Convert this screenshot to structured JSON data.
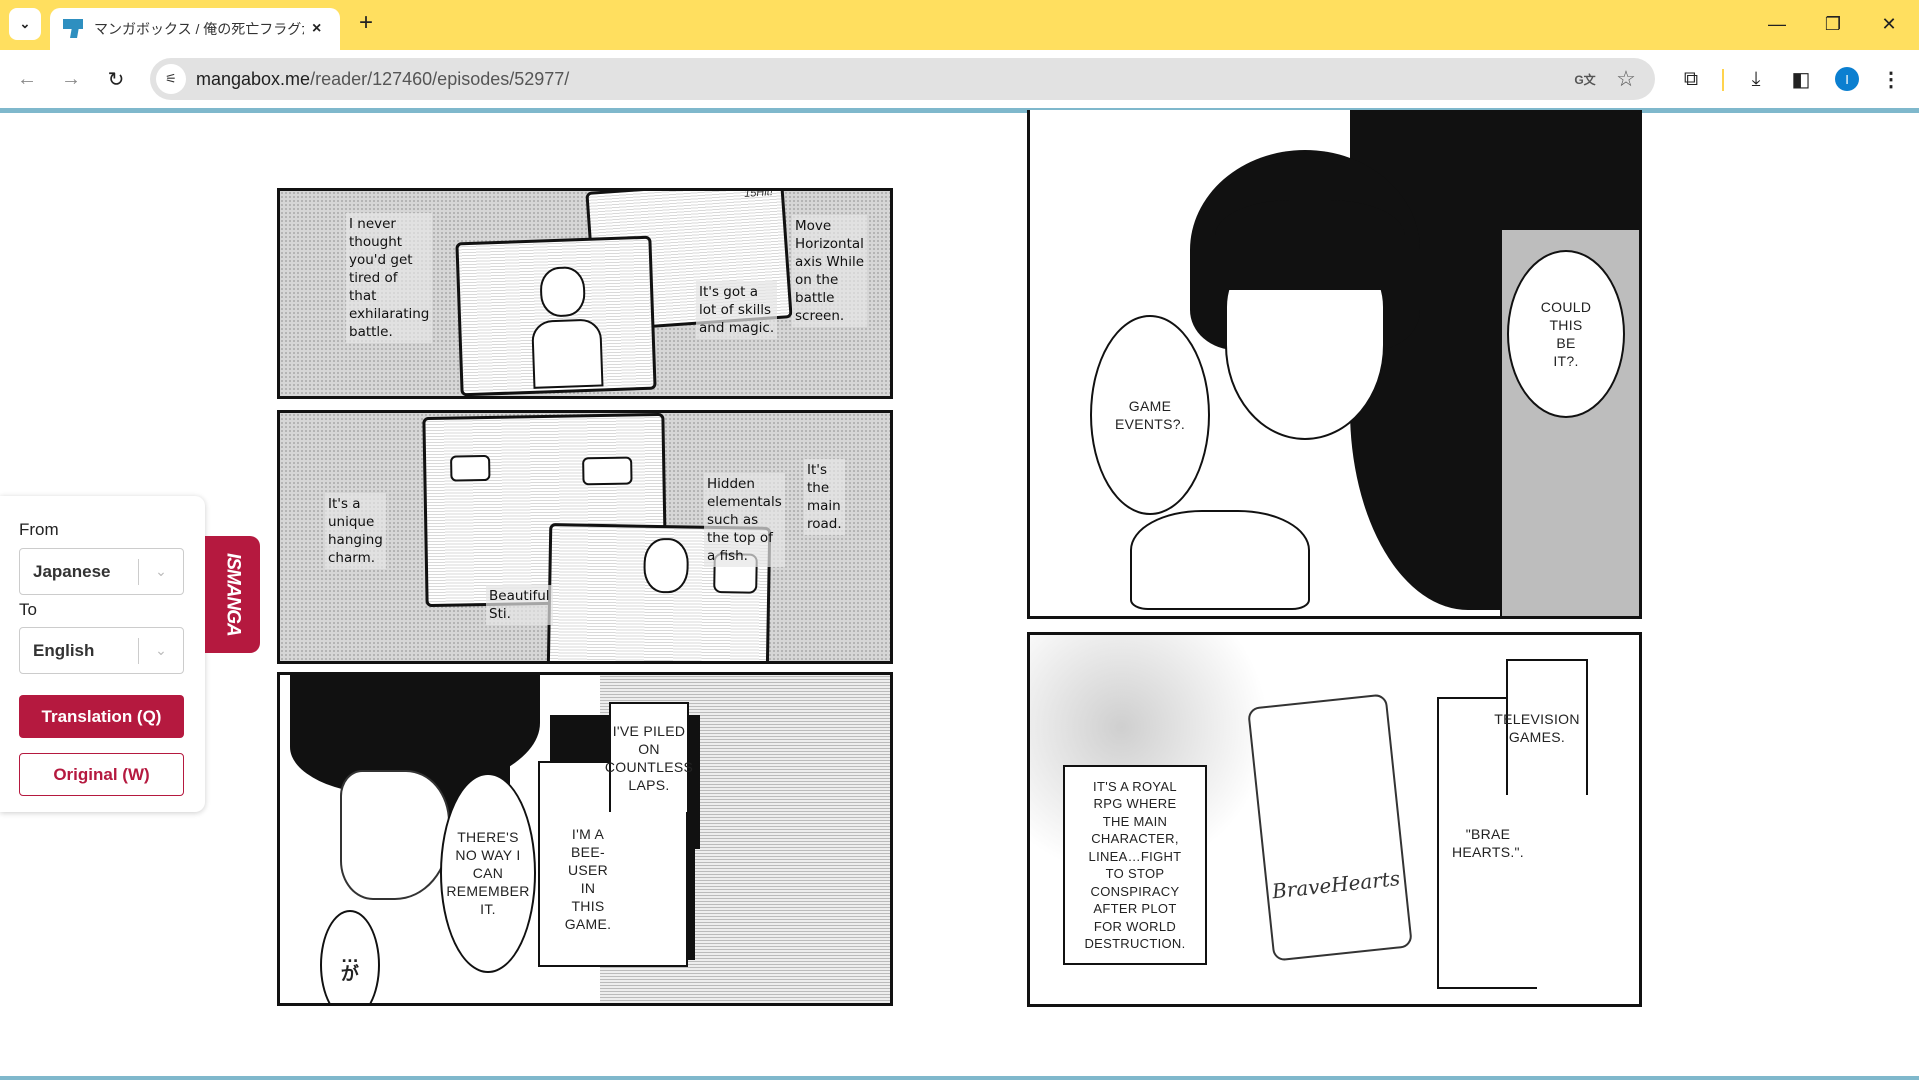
{
  "browser": {
    "tab": {
      "title": "マンガボックス / 俺の死亡フラグが留",
      "close_icon": "×"
    },
    "new_tab_icon": "+",
    "window_controls": {
      "minimize": "—",
      "maximize": "❐",
      "close": "✕"
    },
    "nav": {
      "back": "←",
      "forward": "→",
      "reload": "↻"
    },
    "address": {
      "host": "mangabox.me",
      "path": "/reader/127460/episodes/52977/"
    },
    "omnibox_icons": {
      "translate": "G文",
      "bookmark": "☆"
    },
    "toolbar_icons": {
      "extensions": "⧉",
      "download": "⤓",
      "side_panel": "◧",
      "menu": "⋮"
    },
    "profile_initial": "I"
  },
  "translator": {
    "from_label": "From",
    "from_value": "Japanese",
    "to_label": "To",
    "to_value": "English",
    "chevron": "⌄",
    "translate_button": "Translation (Q)",
    "original_button": "Original (W)",
    "brand_tab": "ISMANGA"
  },
  "manga": {
    "left_page": {
      "panel1": {
        "caption_a": "I never\nthought\nyou'd get\ntired of\nthat\nexhilarating\nbattle.",
        "caption_b": "It's got a\nlot of skills\nand magic.",
        "caption_c": "Move\nHorizontal\naxis While\non the\nbattle\nscreen.",
        "sfx": "15Hit!"
      },
      "panel2": {
        "caption_a": "It's a\nunique\nhanging\ncharm.",
        "caption_b": "Beautiful\nSti.",
        "caption_c": "Hidden\nelementals\nsuch as\nthe top of\na fish.",
        "caption_d": "It's\nthe\nmain\nroad."
      },
      "panel3": {
        "bubble_a": "THERE'S\nNO WAY I\nCAN\nREMEMBER\nIT.",
        "box_a": "I'M A\nBEE-\nUSER\nIN\nTHIS\nGAME.",
        "box_b": "I'VE PILED\nON\nCOUNTLESS\nLAPS.",
        "thought": "…\nが"
      }
    },
    "right_page": {
      "panel1": {
        "bubble_a": "GAME\nEVENTS?.",
        "bubble_b": "COULD\nTHIS\nBE\nIT?."
      },
      "panel2": {
        "box_a": "IT'S A ROYAL\nRPG WHERE\nTHE MAIN\nCHARACTER,\nLINEA…FIGHT\nTO STOP\nCONSPIRACY\nAFTER PLOT\nFOR WORLD\nDESTRUCTION.",
        "box_b": "TELEVISION\nGAMES.",
        "box_c": "\"BRAE\nHEARTS.\".",
        "game_logo": "BraveHearts"
      }
    }
  }
}
